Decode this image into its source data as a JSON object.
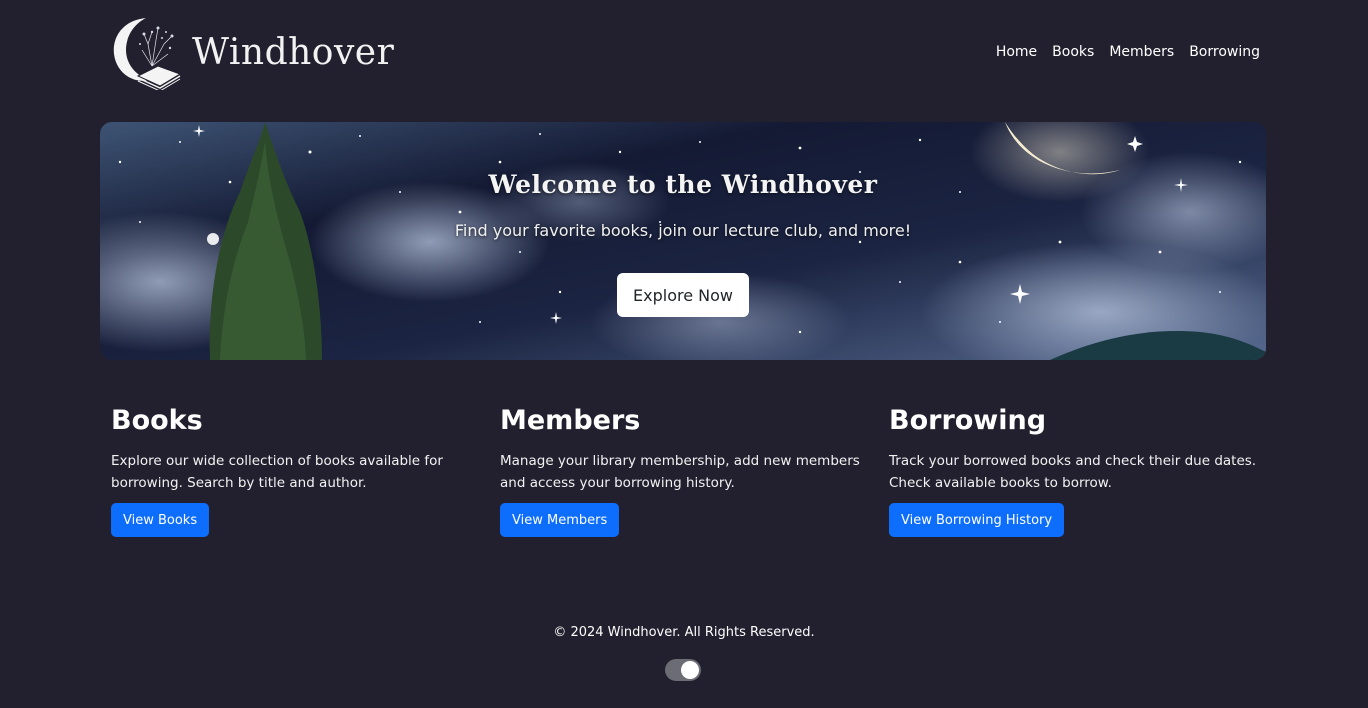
{
  "header": {
    "brand_name": "Windhover",
    "nav": [
      {
        "label": "Home"
      },
      {
        "label": "Books"
      },
      {
        "label": "Members"
      },
      {
        "label": "Borrowing"
      }
    ]
  },
  "hero": {
    "title": "Welcome to the Windhover",
    "subtitle": "Find your favorite books, join our lecture club, and more!",
    "button_label": "Explore Now"
  },
  "cards": [
    {
      "title": "Books",
      "text": "Explore our wide collection of books available for borrowing. Search by title and author.",
      "button_label": "View Books"
    },
    {
      "title": "Members",
      "text": "Manage your library membership, add new members and access your borrowing history.",
      "button_label": "View Members"
    },
    {
      "title": "Borrowing",
      "text": "Track your borrowed books and check their due dates. Check available books to borrow.",
      "button_label": "View Borrowing History"
    }
  ],
  "footer": {
    "copyright": "© 2024 Windhover. All Rights Reserved.",
    "theme_toggle_on": true
  },
  "colors": {
    "background": "#22202e",
    "primary_button": "#0d6efd",
    "hero_button": "#ffffff"
  },
  "icons": {
    "logo": "crescent-moon-book-icon",
    "toggle": "theme-toggle-icon"
  }
}
